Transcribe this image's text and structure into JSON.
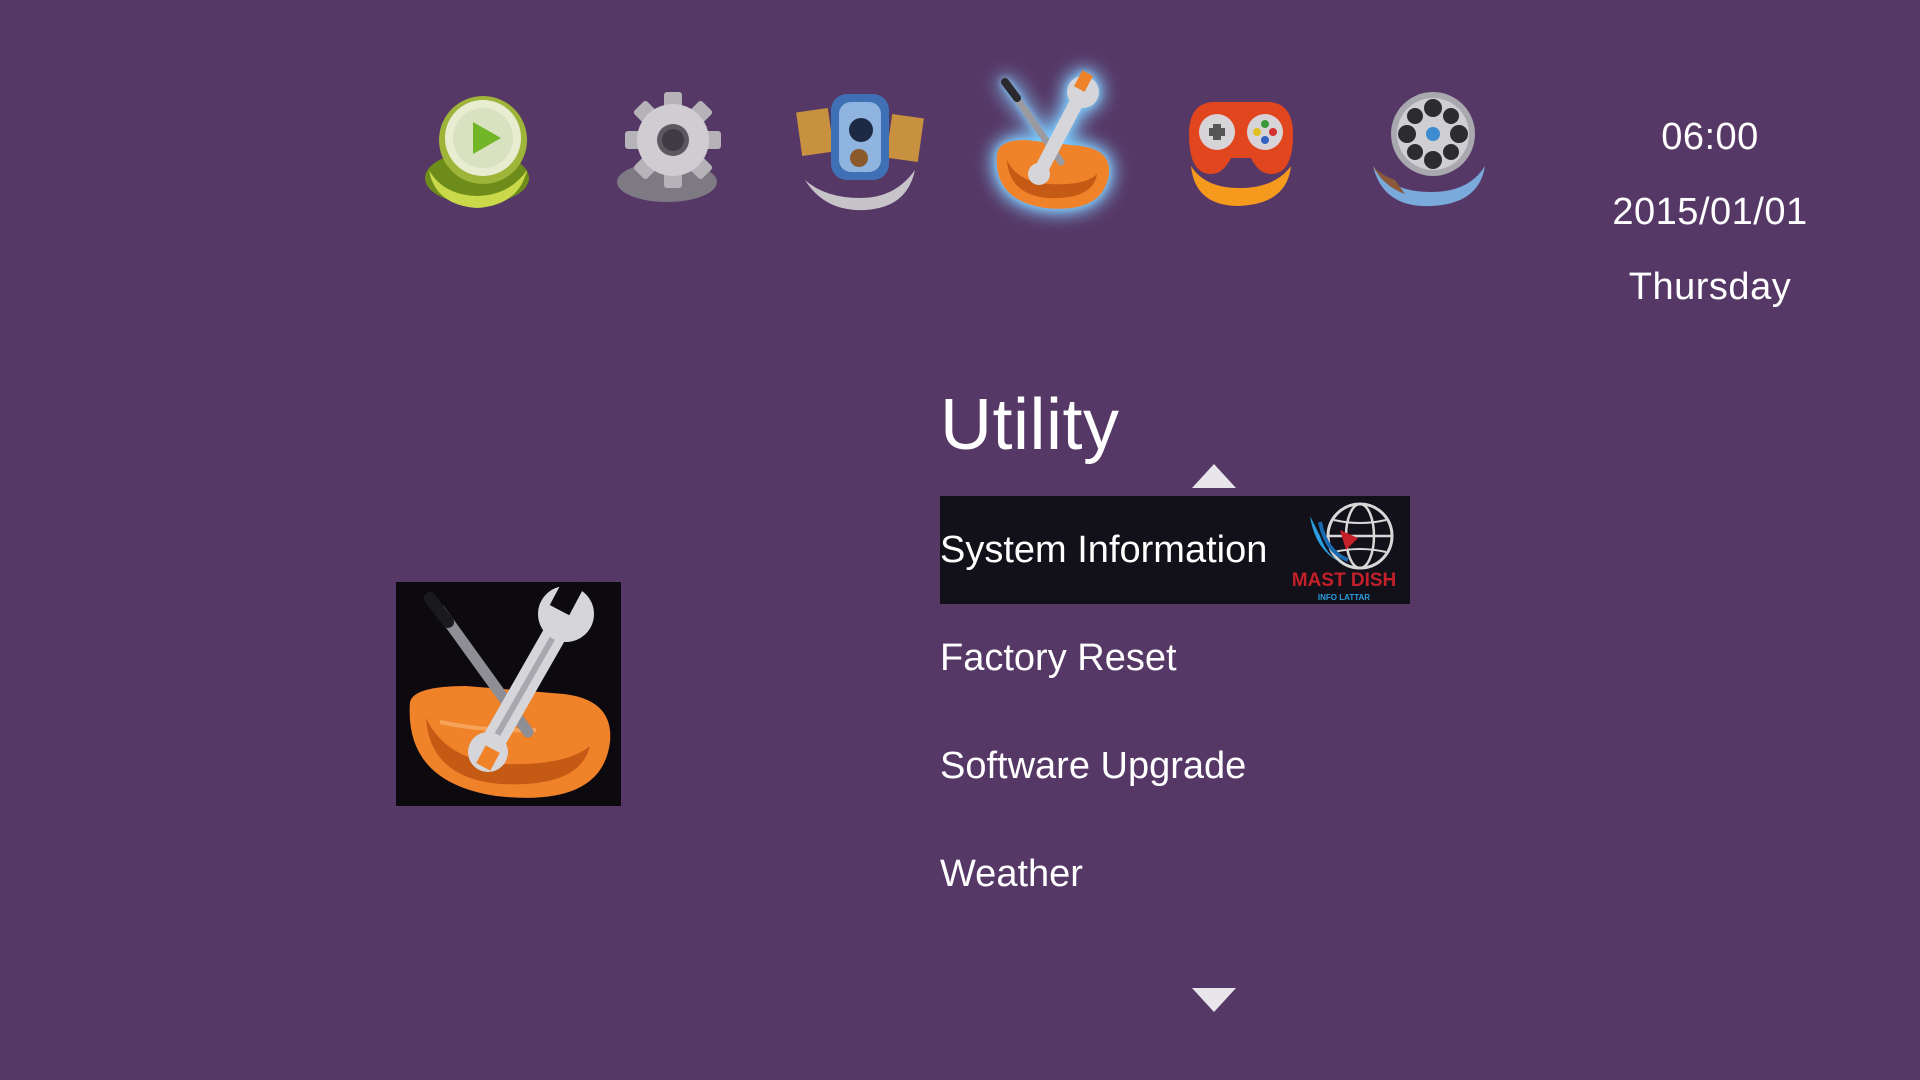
{
  "nav": {
    "items": [
      {
        "name": "media-player",
        "icon": "play-icon",
        "selected": false
      },
      {
        "name": "system-setup",
        "icon": "gear-icon",
        "selected": false
      },
      {
        "name": "installation",
        "icon": "satellite-icon",
        "selected": false
      },
      {
        "name": "utility",
        "icon": "tools-icon",
        "selected": true
      },
      {
        "name": "games",
        "icon": "gamepad-icon",
        "selected": false
      },
      {
        "name": "multimedia",
        "icon": "film-reel-icon",
        "selected": false
      }
    ]
  },
  "clock": {
    "time": "06:00",
    "date": "2015/01/01",
    "day": "Thursday"
  },
  "section": {
    "title": "Utility"
  },
  "menu": {
    "items": [
      {
        "label": "System Information",
        "highlighted": true
      },
      {
        "label": "Factory Reset",
        "highlighted": false
      },
      {
        "label": "Software Upgrade",
        "highlighted": false
      },
      {
        "label": "Weather",
        "highlighted": false
      }
    ]
  },
  "watermark": {
    "brand": "MAST DISH",
    "subtext": "INFO LATTAR"
  },
  "colors": {
    "background": "#563866",
    "highlight": "#121018",
    "text": "#ffffff",
    "accent_glow": "#6cc7ff",
    "orange": "#f0822a"
  }
}
